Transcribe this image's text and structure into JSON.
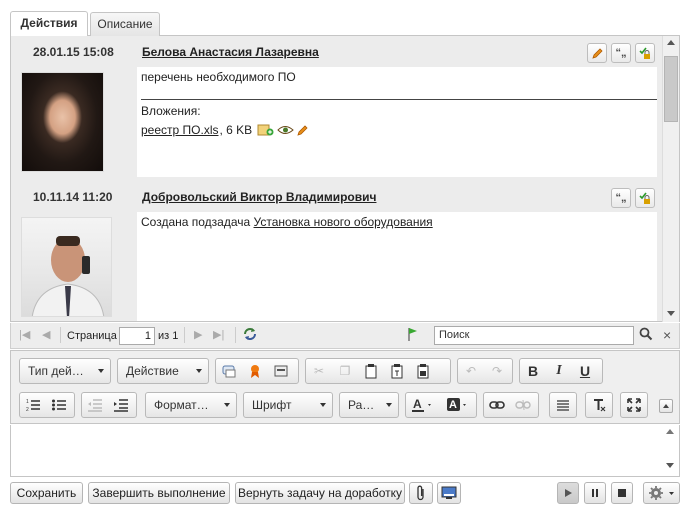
{
  "tabs": [
    {
      "label": "Действия"
    },
    {
      "label": "Описание"
    }
  ],
  "entries": [
    {
      "date": "28.01.15 15:08",
      "author": "Белова Анастасия Лазаревна",
      "text": "перечень необходимого ПО",
      "attachments_label": "Вложения:",
      "file_name": "реестр ПО.xls",
      "file_size": ", 6 KB"
    },
    {
      "date": "10.11.14 11:20",
      "author": "Добровольский Виктор Владимирович",
      "text_prefix": "Создана подзадача ",
      "link_text": "Установка нового оборудования"
    }
  ],
  "pager": {
    "page_label": "Страница",
    "page_value": "1",
    "of_label": "из 1",
    "search_placeholder": "Поиск"
  },
  "toolbar": {
    "action_type": "Тип дей…",
    "action": "Действие",
    "format": "Формат…",
    "font": "Шрифт",
    "size": "Ра…"
  },
  "buttons": {
    "save": "Сохранить",
    "finish": "Завершить выполнение",
    "return": "Вернуть задачу на доработку"
  },
  "colors": {
    "accent_orange": "#e07a10",
    "link": "#222222",
    "panel": "#ececec"
  }
}
